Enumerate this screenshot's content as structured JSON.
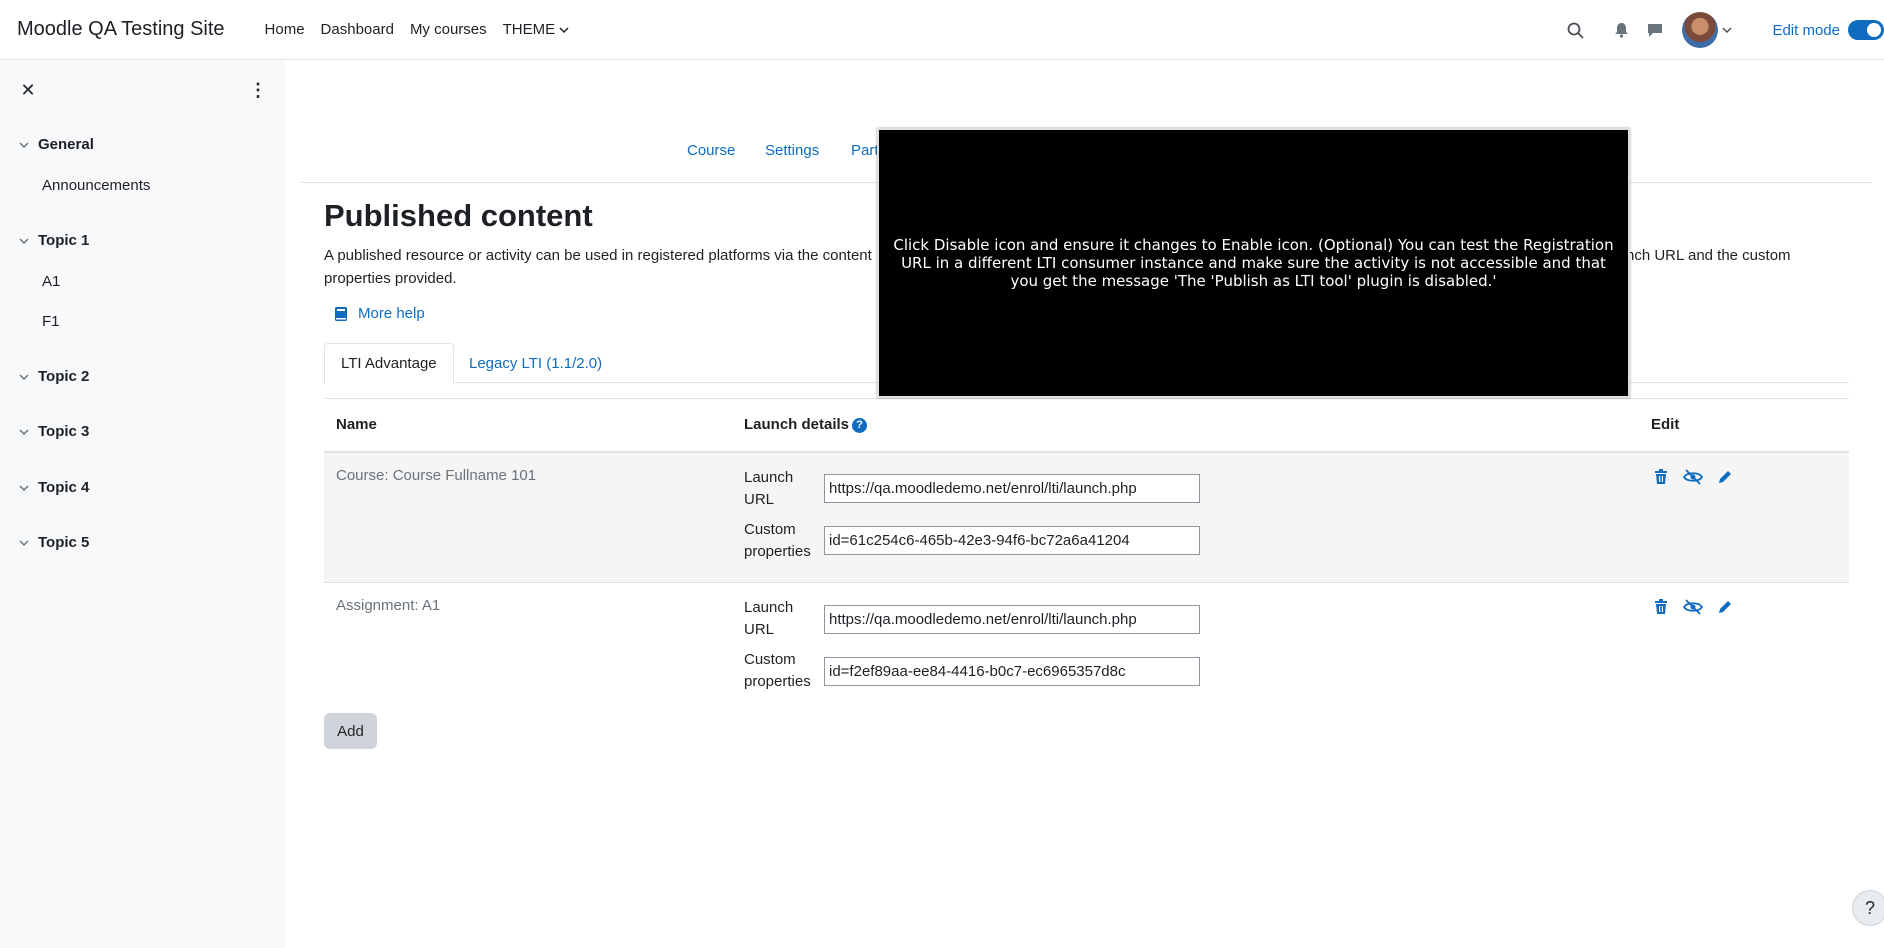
{
  "site": {
    "name": "Moodle QA Testing Site"
  },
  "primary_nav": [
    {
      "label": "Home"
    },
    {
      "label": "Dashboard"
    },
    {
      "label": "My courses"
    },
    {
      "label": "THEME"
    }
  ],
  "user_nav": {
    "edit_mode_label": "Edit mode",
    "edit_mode_on": true
  },
  "drawer": {
    "sections": [
      {
        "title": "General",
        "items": [
          "Announcements"
        ]
      },
      {
        "title": "Topic 1",
        "items": [
          "A1",
          "F1"
        ]
      },
      {
        "title": "Topic 2",
        "items": []
      },
      {
        "title": "Topic 3",
        "items": []
      },
      {
        "title": "Topic 4",
        "items": []
      },
      {
        "title": "Topic 5",
        "items": []
      }
    ]
  },
  "secondary_nav": [
    {
      "label": "Course"
    },
    {
      "label": "Settings"
    },
    {
      "label": "Part"
    }
  ],
  "page": {
    "title": "Published content",
    "intro_left": "A published resource or activity can be used in registered platforms via the content",
    "intro_right": "nch URL and the custom",
    "intro_line2": "properties provided.",
    "more_help": "More help"
  },
  "tabs": [
    {
      "label": "LTI Advantage",
      "active": true
    },
    {
      "label": "Legacy LTI (1.1/2.0)",
      "active": false
    }
  ],
  "table": {
    "headers": {
      "name": "Name",
      "launch": "Launch details",
      "edit": "Edit"
    },
    "launch_url_label_1": "Launch",
    "launch_url_label_2": "URL",
    "custom_label_1": "Custom",
    "custom_label_2": "properties",
    "rows": [
      {
        "name": "Course: Course Fullname 101",
        "launch_url": "https://qa.moodledemo.net/enrol/lti/launch.php",
        "custom_properties": "id=61c254c6-465b-42e3-94f6-bc72a6a41204"
      },
      {
        "name": "Assignment: A1",
        "launch_url": "https://qa.moodledemo.net/enrol/lti/launch.php",
        "custom_properties": "id=f2ef89aa-ee84-4416-b0c7-ec6965357d8c"
      }
    ]
  },
  "add_button": "Add",
  "help_fab": "?",
  "overlay": {
    "text": "Click Disable icon and ensure it changes to Enable icon. (Optional) You can test the Registration URL in a different LTI consumer instance and make sure the activity is not accessible and that you get the message 'The 'Publish as LTI tool' plugin is disabled.'"
  },
  "colors": {
    "link": "#0f6cbf",
    "drawer_bg": "#f8f9fa",
    "overlay_bg": "#000000"
  },
  "icons": [
    "close-icon",
    "kebab-icon",
    "chevron-down-icon",
    "search-icon",
    "bell-icon",
    "chat-icon",
    "book-icon",
    "trash-icon",
    "eye-slash-icon",
    "pencil-icon",
    "help-icon"
  ]
}
